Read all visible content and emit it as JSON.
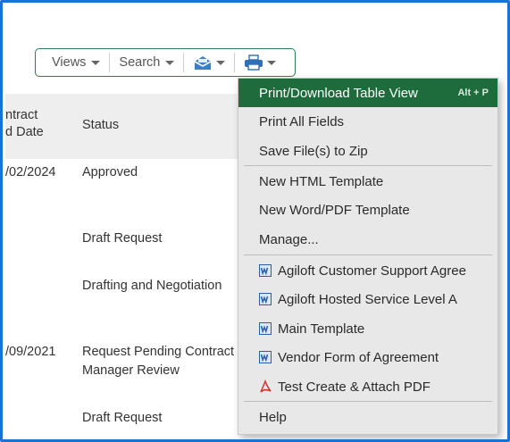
{
  "toolbar": {
    "views_label": "Views",
    "search_label": "Search"
  },
  "table": {
    "headers": {
      "contract_line1": "ntract",
      "contract_line2": "d Date",
      "status": "Status"
    },
    "rows": [
      {
        "date": "/02/2024",
        "status": "Approved"
      },
      {
        "date": "",
        "status": "Draft Request"
      },
      {
        "date": "",
        "status": "Drafting and Negotiation"
      },
      {
        "date": "/09/2021",
        "status_line1": "Request Pending Contract",
        "status_line2": "Manager Review"
      },
      {
        "date": "",
        "status": "Draft Request"
      }
    ]
  },
  "menu": {
    "items": [
      {
        "label": "Print/Download Table View",
        "shortcut": "Alt + P",
        "active": true
      },
      {
        "label": "Print All Fields"
      },
      {
        "label": "Save File(s) to Zip"
      },
      {
        "label": "New HTML Template"
      },
      {
        "label": "New Word/PDF Template"
      },
      {
        "label": "Manage..."
      },
      {
        "label": "Agiloft Customer Support Agree",
        "icon": "word-doc-icon"
      },
      {
        "label": "Agiloft Hosted Service Level A",
        "icon": "word-doc-icon"
      },
      {
        "label": "Main Template",
        "icon": "word-doc-icon"
      },
      {
        "label": "Vendor Form of Agreement",
        "icon": "word-doc-icon"
      },
      {
        "label": "Test Create & Attach PDF",
        "icon": "pdf-icon"
      },
      {
        "label": "Help"
      }
    ]
  },
  "colors": {
    "accent_green": "#1e6b3c",
    "frame_blue": "#1a73d0",
    "email_icon_blue": "#3b7fc4",
    "print_icon_blue": "#2f6fb8"
  }
}
